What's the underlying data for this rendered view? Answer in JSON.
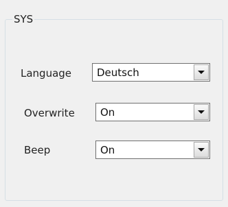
{
  "group": {
    "title": "SYS"
  },
  "settings": {
    "language": {
      "label": "Language",
      "value": "Deutsch"
    },
    "overwrite": {
      "label": "Overwrite",
      "value": "On"
    },
    "beep": {
      "label": "Beep",
      "value": "On"
    }
  },
  "icons": {
    "dropdown": "chevron-down-icon"
  }
}
